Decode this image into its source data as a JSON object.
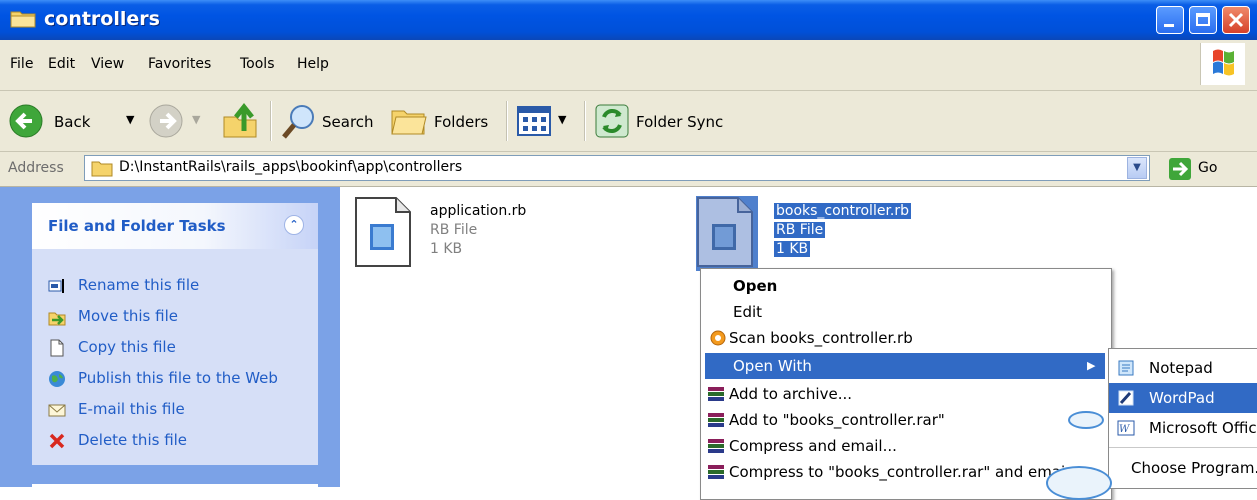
{
  "window": {
    "title": "controllers"
  },
  "menubar": {
    "items": [
      "File",
      "Edit",
      "View",
      "Favorites",
      "Tools",
      "Help"
    ]
  },
  "toolbar": {
    "back": "Back",
    "search": "Search",
    "folders": "Folders",
    "folder_sync": "Folder Sync"
  },
  "address": {
    "label": "Address",
    "path": "D:\\InstantRails\\rails_apps\\bookinf\\app\\controllers",
    "go": "Go"
  },
  "tasks": {
    "title": "File and Folder Tasks",
    "items": [
      {
        "label": "Rename this file",
        "icon": "rename-icon"
      },
      {
        "label": "Move this file",
        "icon": "move-icon"
      },
      {
        "label": "Copy this file",
        "icon": "copy-icon"
      },
      {
        "label": "Publish this file to the Web",
        "icon": "globe-icon"
      },
      {
        "label": "E-mail this file",
        "icon": "email-icon"
      },
      {
        "label": "Delete this file",
        "icon": "delete-icon"
      }
    ]
  },
  "files": [
    {
      "name": "application.rb",
      "type": "RB File",
      "size": "1 KB",
      "selected": false
    },
    {
      "name": "books_controller.rb",
      "type": "RB File",
      "size": "1 KB",
      "selected": true
    }
  ],
  "context_menu": {
    "items": [
      "Open",
      "Edit",
      "Scan books_controller.rb",
      "Open With",
      "Add to archive...",
      "Add to \"books_controller.rar\"",
      "Compress and email...",
      "Compress to \"books_controller.rar\" and email"
    ]
  },
  "submenu": {
    "items": [
      "Notepad",
      "WordPad",
      "Microsoft Office",
      "Choose Program..."
    ]
  },
  "colors": {
    "title_bar": "#0054e3",
    "selection": "#316ac5",
    "task_link": "#215dc6",
    "chrome": "#ece9d8"
  }
}
